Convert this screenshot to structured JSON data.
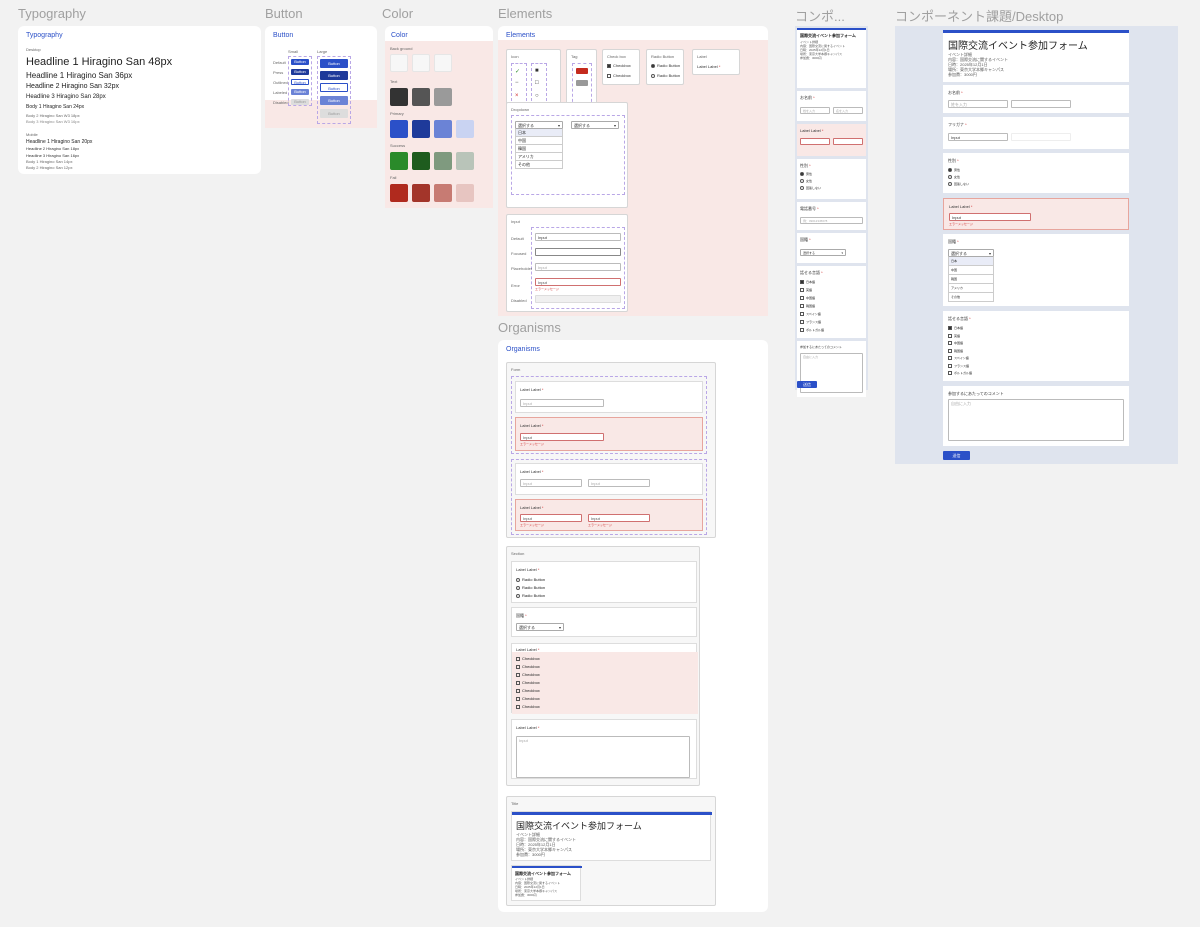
{
  "frames": {
    "typography": "Typography",
    "button": "Button",
    "color": "Color",
    "elements": "Elements",
    "organisms": "Organisms",
    "mobile": "コンポ...",
    "desktop": "コンポーネント課題/Desktop"
  },
  "typography": {
    "card_title": "Typography",
    "desktop_label": "Desktop",
    "h1_48": "Headline 1 Hiragino  San 48px",
    "h1_36": "Headline 1 Hiragino  San 36px",
    "h2_32": "Headline 2 Hiragino  San 32px",
    "h3_28": "Headline 3 Hiragino  San 28px",
    "body1_24": "Body 1 Hiragino  San 24px",
    "body2": "Body 2 Hiragino  San W3 18px",
    "body3": "Body 3 Hiragino  San W3 16px",
    "mobile_label": "Mobile",
    "m_h1": "Headline 1 Hiragino  San 20px",
    "m_h2": "Headline 2 Hiragino  San 18px",
    "m_h3": "Headline 3 Hiragino  San 16px",
    "m_b1": "Body 1 Hiragino  San 14px",
    "m_b2": "Body 2 Hiragino  San 12px"
  },
  "button": {
    "card_title": "Button",
    "col_small": "Small",
    "col_large": "Large",
    "rows": [
      "Default",
      "Press",
      "Outlined",
      "Labeled",
      "Disabled"
    ],
    "label": "Button"
  },
  "color": {
    "card_title": "Color",
    "groups": [
      "Back ground",
      "Text",
      "Primary",
      "Success",
      "Fail"
    ],
    "bg": [
      "#f7f7f7",
      "#f7f7f7",
      "#f7f7f7"
    ],
    "text": [
      "#333333",
      "#555555",
      "#9a9a9a"
    ],
    "primary": [
      "#2b50c8",
      "#1e3a9a",
      "#6b83d6",
      "#c9d3f2"
    ],
    "success": [
      "#2a8a2a",
      "#1e5c1e",
      "#7f9a7f",
      "#b9c4b9"
    ],
    "fail": [
      "#b02a1e",
      "#a3352a",
      "#c77b73",
      "#e7c5c1"
    ]
  },
  "elements": {
    "card_title": "Elements",
    "icon_label": "Icon",
    "tag_label": "Tag",
    "checkbox_label": "Check box",
    "checkbox_item": "Checkbox",
    "radio_label": "Radio Button",
    "radio_item": "Radio Button",
    "label_label": "Label",
    "label_item": "Label Label",
    "dropdown_label": "Dropdown",
    "select_placeholder": "選択する",
    "dropdown_options": [
      "日本",
      "中国",
      "韓国",
      "アメリカ",
      "その他"
    ],
    "input_label": "Input",
    "input_states": [
      "Default",
      "Focused",
      "Placeholder",
      "Error",
      "Disabled"
    ],
    "input_value": "Input",
    "input_placeholder": "Input",
    "error_msg": "エラーメッセージ"
  },
  "organisms": {
    "card_title": "Organisms",
    "form_label": "Form",
    "label_label": "Label Label",
    "input_placeholder": "Input",
    "input_value": "Input",
    "error_msg": "エラーメッセージ",
    "section_label": "Section",
    "radio_item": "Radio Button",
    "country_label": "国籍",
    "select_placeholder": "選択する",
    "checkbox_item": "Checkbox",
    "textarea_placeholder": "Input",
    "title_label": "Title",
    "form_title": "国際交流イベント参加フォーム",
    "event_info": [
      "イベント詳細",
      "内容：国際交流に関するイベント",
      "日時：2025年12月1日",
      "場所：東京大学本郷キャンパス",
      "参加費：3000円"
    ]
  },
  "mobile": {
    "form_title": "国際交流イベント参加フォーム",
    "name_label": "お名前",
    "last_placeholder": "姓を入力",
    "first_placeholder": "名を入力",
    "label_label": "Label Label",
    "gender_label": "性別",
    "gender_options": [
      "男性",
      "女性",
      "回答しない"
    ],
    "phone_label": "電話番号",
    "phone_placeholder": "例：09012345678",
    "country_label": "国籍",
    "select_placeholder": "選択する",
    "language_label": "話せる言語",
    "languages": [
      "日本語",
      "英語",
      "中国語",
      "韓国語",
      "スペイン語",
      "フランス語",
      "ポルトガル語"
    ],
    "comment_label": "参加するにあたってのコメント",
    "comment_placeholder": "自由に入力",
    "submit": "送信"
  },
  "desktop": {
    "form_title": "国際交流イベント参加フォーム",
    "event_info": [
      "イベント詳細",
      "内容：国際交流に関するイベント",
      "日時：2025年12月1日",
      "場所：東京大学本郷キャンパス",
      "参加費：3000円"
    ],
    "name_label": "お名前",
    "last_placeholder": "姓を入力",
    "furigana_label": "フリガナ",
    "furigana_value": "Input",
    "gender_label": "性別",
    "gender_options": [
      "男性",
      "女性",
      "回答しない"
    ],
    "label_label": "Label Label",
    "input_value": "Input",
    "error_msg": "エラーメッセージ",
    "country_label": "国籍",
    "select_placeholder": "選択する",
    "country_options": [
      "日本",
      "中国",
      "韓国",
      "アメリカ",
      "その他"
    ],
    "language_label": "話せる言語",
    "languages": [
      "日本語",
      "英語",
      "中国語",
      "韓国語",
      "スペイン語",
      "フランス語",
      "ポルトガル語"
    ],
    "comment_label": "参加するにあたってのコメント",
    "comment_placeholder": "自由に入力",
    "submit": "送信"
  }
}
